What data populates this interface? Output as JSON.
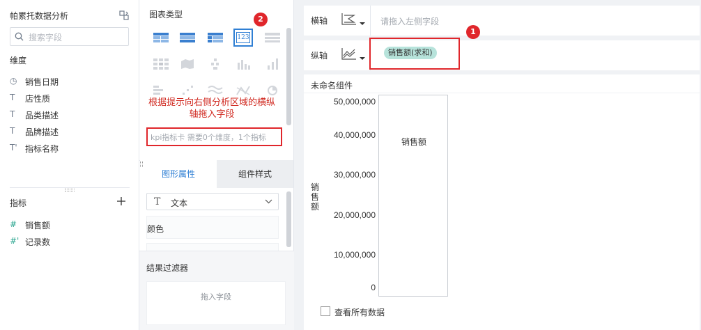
{
  "left_panel": {
    "dataset_title": "帕累托数据分析",
    "search_placeholder": "搜索字段",
    "dimensions_label": "维度",
    "dimensions": [
      {
        "type_icon": "◷",
        "label": "销售日期"
      },
      {
        "type_icon": "T",
        "label": "店性质"
      },
      {
        "type_icon": "T",
        "label": "品类描述"
      },
      {
        "type_icon": "T",
        "label": "品牌描述"
      },
      {
        "type_icon": "T'",
        "label": "指标名称"
      }
    ],
    "measures_label": "指标",
    "measures": [
      {
        "type_icon": "#",
        "label": "销售额"
      },
      {
        "type_icon": "#'",
        "label": "记录数"
      }
    ]
  },
  "middle_panel": {
    "chart_type_title": "图表类型",
    "selected_chart_icon_text": "123",
    "hint_text": "根据提示向右侧分析区域的横纵轴拖入字段",
    "kpi_tip": "kpi指标卡 需要0个维度，1个指标",
    "badge_2": "2",
    "tabs": [
      "图形属性",
      "组件样式"
    ],
    "attr_dropdown_icon": "T",
    "attr_dropdown_label": "文本",
    "color_label": "颜色",
    "result_filter_title": "结果过滤器",
    "drop_field_text": "拖入字段"
  },
  "right_panel": {
    "x_axis_label": "横轴",
    "x_axis_placeholder": "请拖入左侧字段",
    "y_axis_label": "纵轴",
    "y_axis_pill": "销售额(求和)",
    "badge_1": "1",
    "component_title": "未命名组件",
    "chart_y_title": "销售额",
    "chart_series_label": "销售额",
    "y_ticks": [
      "50,000,000",
      "40,000,000",
      "30,000,000",
      "20,000,000",
      "10,000,000",
      "0"
    ],
    "show_all_data_label": "查看所有数据"
  },
  "colors": {
    "accent": "#2f7fd4",
    "annotation_red": "#e0262b",
    "pill_bg": "#b7e3db"
  }
}
